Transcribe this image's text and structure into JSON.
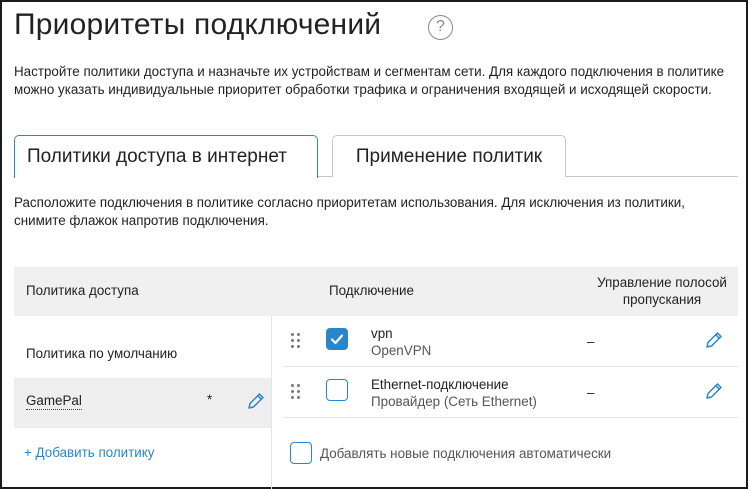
{
  "page": {
    "title": "Приоритеты подключений",
    "help_icon": "?",
    "description": "Настройте политики доступа и назначьте их устройствам и сегментам сети. Для каждого подключения в политике можно указать индивидуальные приоритет обработки трафика и ограничения входящей и исходящей скорости."
  },
  "tabs": [
    {
      "label": "Политики доступа в интернет",
      "active": true
    },
    {
      "label": "Применение политик",
      "active": false
    }
  ],
  "instructions": "Расположите подключения в политике согласно приоритетам использования. Для исключения из политики, снимите флажок напротив подключения.",
  "table": {
    "headers": {
      "policy": "Политика доступа",
      "connection": "Подключение",
      "bandwidth": "Управление полосой пропускания"
    }
  },
  "policies": [
    {
      "name": "Политика по умолчанию"
    },
    {
      "name": "GamePal",
      "marker": "*",
      "selected": true
    }
  ],
  "add_policy_label": "+ Добавить политику",
  "connections": [
    {
      "name": "vpn",
      "subtitle": "OpenVPN",
      "checked": true,
      "bandwidth": "–"
    },
    {
      "name": "Ethernet-подключение",
      "subtitle": "Провайдер (Сеть Ethernet)",
      "checked": false,
      "bandwidth": "–"
    }
  ],
  "auto_add_label": "Добавлять новые подключения автоматически",
  "colors": {
    "accent": "#2a86c8",
    "header_bg": "#f0f0f0",
    "selected_bg": "#eeeeee"
  }
}
